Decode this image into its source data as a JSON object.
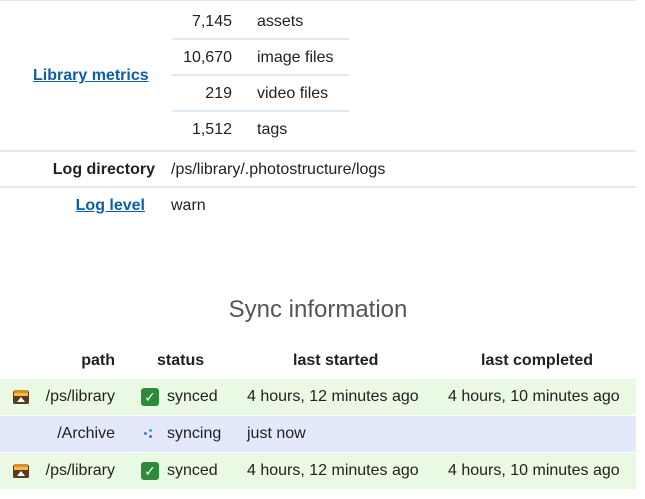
{
  "library_metrics": {
    "label": "Library metrics",
    "items": [
      {
        "value": "7,145",
        "label": "assets"
      },
      {
        "value": "10,670",
        "label": "image files"
      },
      {
        "value": "219",
        "label": "video files"
      },
      {
        "value": "1,512",
        "label": "tags"
      }
    ]
  },
  "log_directory": {
    "label": "Log directory",
    "value": "/ps/library/.photostructure/logs"
  },
  "log_level": {
    "label": "Log level",
    "value": "warn"
  },
  "sync": {
    "title": "Sync information",
    "headers": {
      "path": "path",
      "status": "status",
      "last_started": "last started",
      "last_completed": "last completed"
    },
    "rows": [
      {
        "path": "/ps/library",
        "status": "synced",
        "last_started": "4 hours, 12 minutes ago",
        "last_completed": "4 hours, 10 minutes ago",
        "icon": "folder-icon",
        "status_icon": "check-icon"
      },
      {
        "path": "/Archive",
        "status": "syncing",
        "last_started": "just now",
        "last_completed": "",
        "icon": "",
        "status_icon": "spinner-icon"
      },
      {
        "path": "/ps/library",
        "status": "synced",
        "last_started": "4 hours, 12 minutes ago",
        "last_completed": "4 hours, 10 minutes ago",
        "icon": "folder-icon",
        "status_icon": "check-icon"
      }
    ]
  },
  "colors": {
    "link": "#0b5fa8",
    "synced_row": "#eaf9e3",
    "syncing_row": "#e4e8fb",
    "check": "#2e8b3a"
  }
}
